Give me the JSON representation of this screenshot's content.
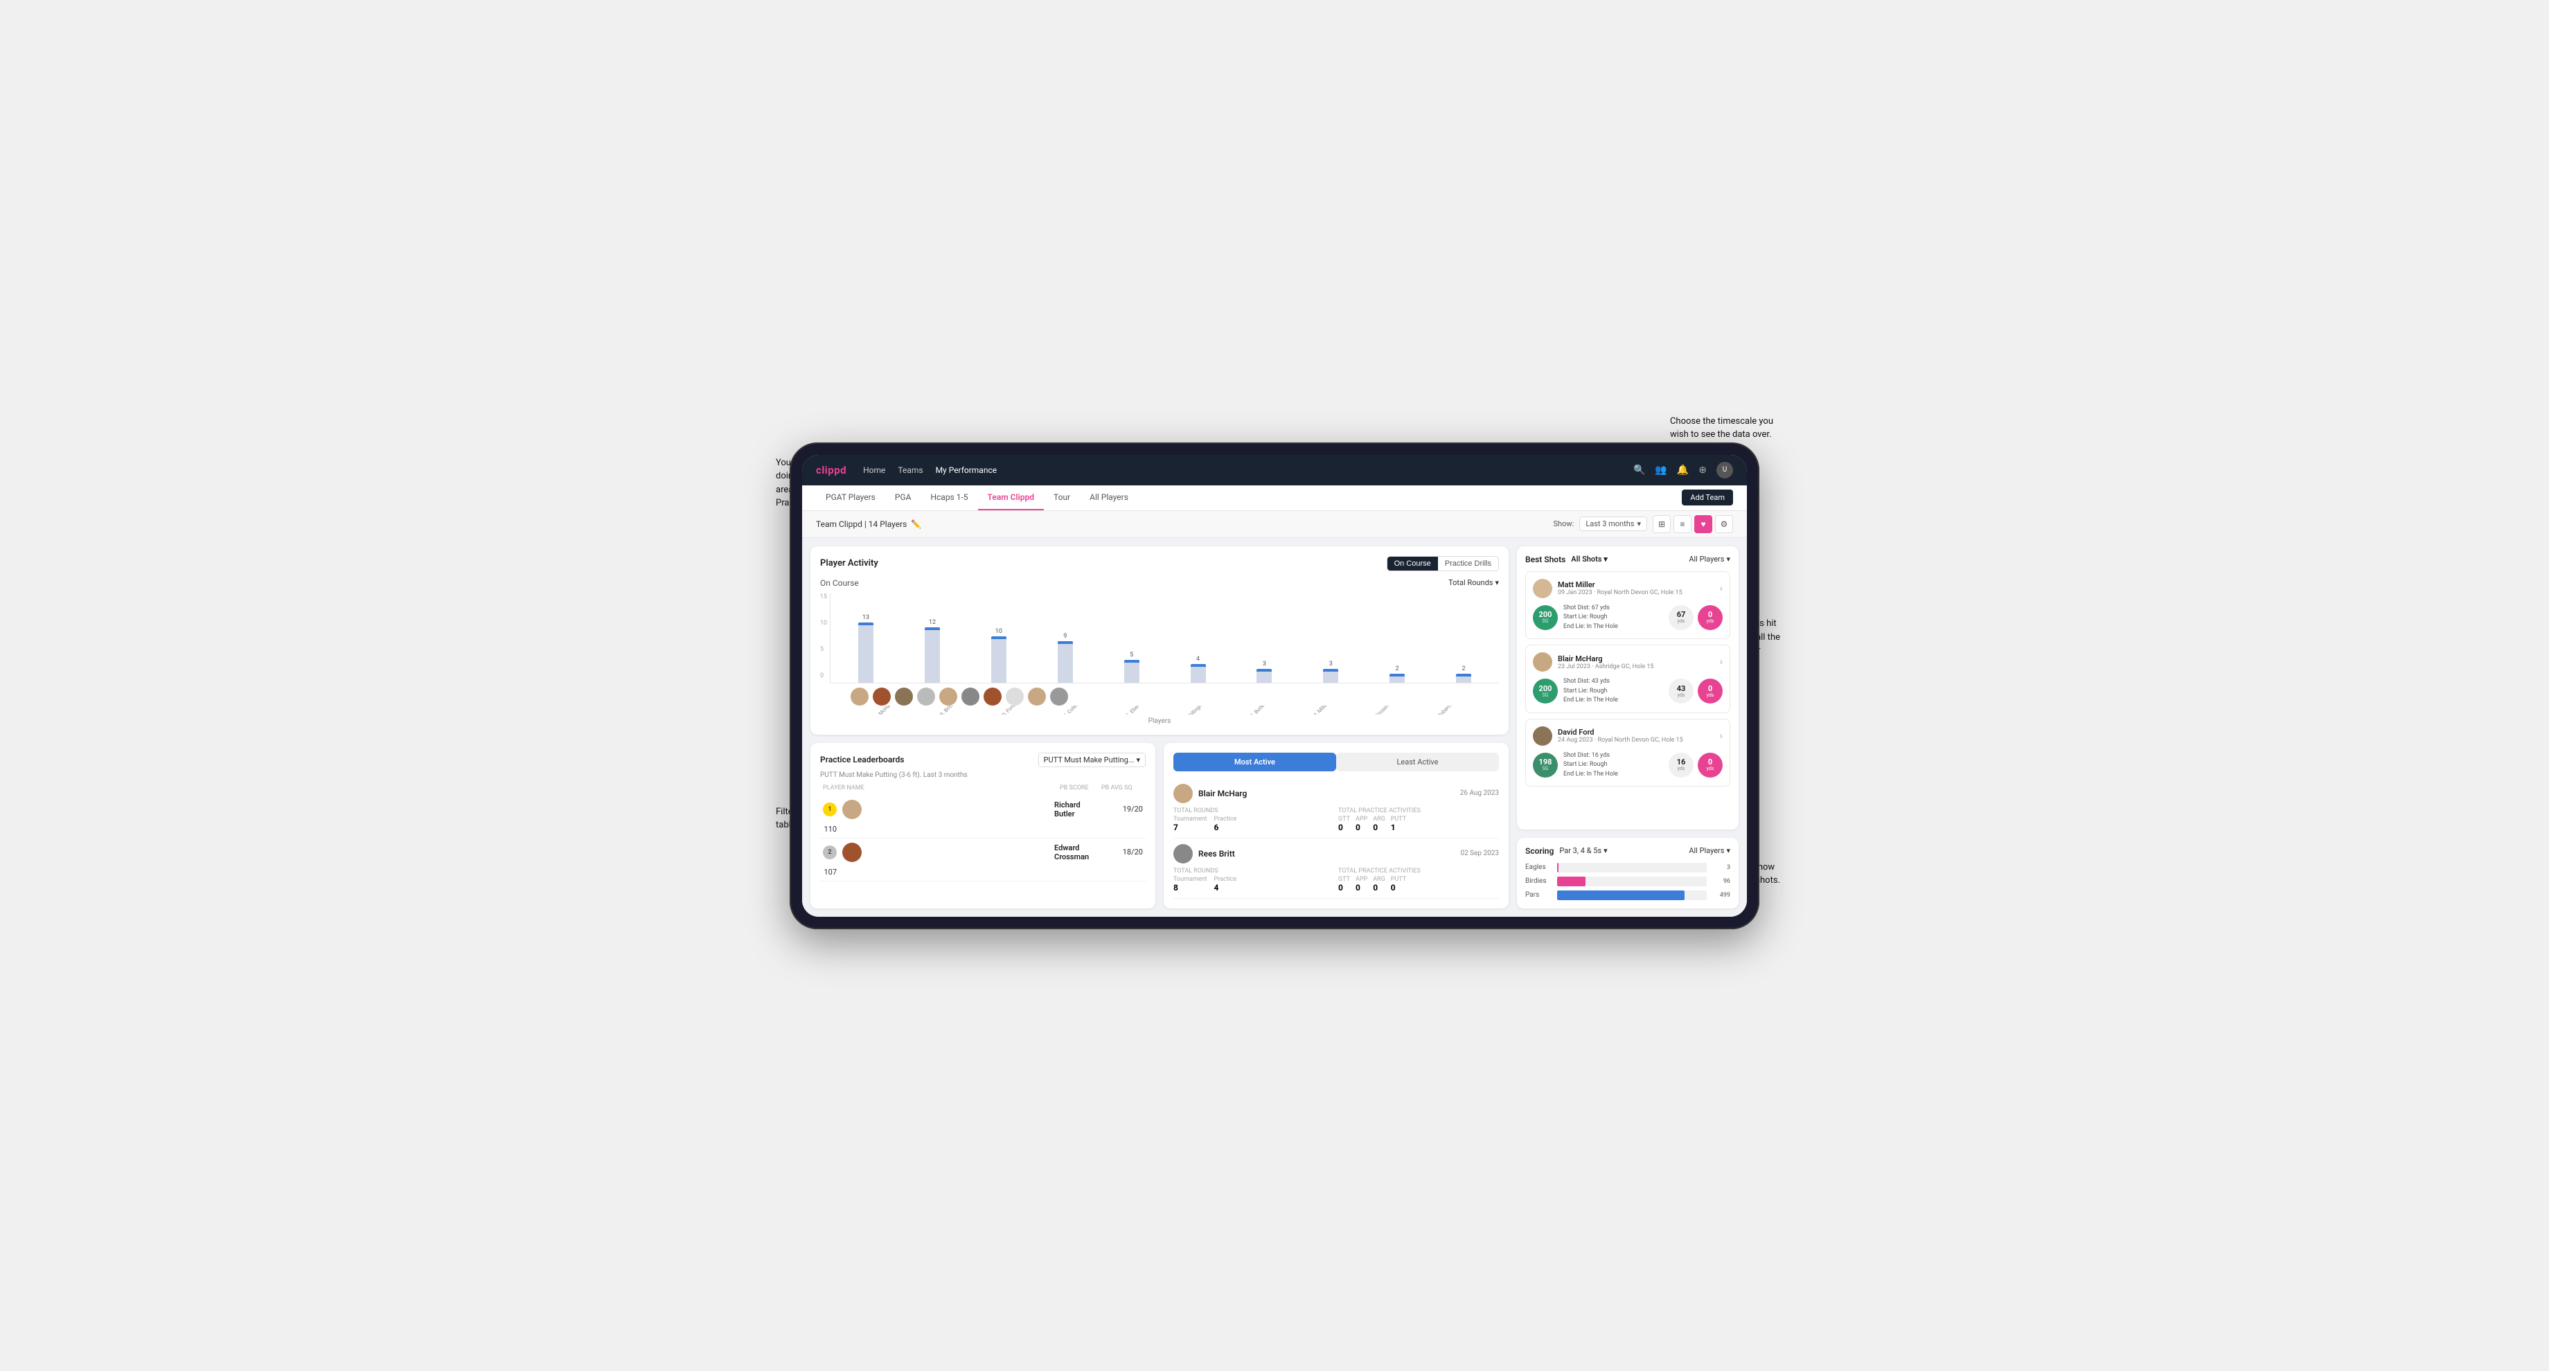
{
  "annotations": {
    "top_right": "Choose the timescale you\nwish to see the data over.",
    "top_left": "You can select which player is\ndoing the best in a range of\nareas for both On Course and\nPractice Drills.",
    "bottom_left": "Filter what data you wish the\ntable to be based on.",
    "right_mid": "Here you can see who's hit\nthe best shots out of all the\nplayers in the team for\neach department.",
    "right_bot": "You can also filter to show\njust one player's best shots."
  },
  "brand": "clippd",
  "top_nav": {
    "links": [
      "Home",
      "Teams",
      "My Performance"
    ],
    "active": "My Performance"
  },
  "sub_nav": {
    "items": [
      "PGAT Players",
      "PGA",
      "Hcaps 1-5",
      "Team Clippd",
      "Tour",
      "All Players"
    ],
    "active": "Team Clippd",
    "add_button": "Add Team"
  },
  "team_header": {
    "team_name": "Team Clippd",
    "player_count": "14 Players",
    "show_label": "Show:",
    "timescale": "Last 3 months"
  },
  "player_activity": {
    "title": "Player Activity",
    "toggle_options": [
      "On Course",
      "Practice Drills"
    ],
    "active_toggle": "On Course",
    "section_title": "On Course",
    "chart_dropdown": "Total Rounds",
    "y_label": "Total Rounds",
    "x_label": "Players",
    "y_axis_values": [
      "15",
      "10",
      "5",
      "0"
    ],
    "bars": [
      {
        "name": "B. McHarg",
        "value": 13,
        "height": 87
      },
      {
        "name": "R. Britt",
        "value": 12,
        "height": 80
      },
      {
        "name": "D. Ford",
        "value": 10,
        "height": 67
      },
      {
        "name": "J. Coles",
        "value": 9,
        "height": 60
      },
      {
        "name": "E. Ebert",
        "value": 5,
        "height": 33
      },
      {
        "name": "O. Billingham",
        "value": 4,
        "height": 27
      },
      {
        "name": "R. Butler",
        "value": 3,
        "height": 20
      },
      {
        "name": "M. Miller",
        "value": 3,
        "height": 20
      },
      {
        "name": "E. Crossman",
        "value": 2,
        "height": 13
      },
      {
        "name": "L. Robertson",
        "value": 2,
        "height": 13
      }
    ]
  },
  "practice_leaderboard": {
    "title": "Practice Leaderboards",
    "dropdown_label": "PUTT Must Make Putting...",
    "subtitle": "PUTT Must Make Putting (3-6 ft). Last 3 months",
    "columns": [
      "PLAYER NAME",
      "PB SCORE",
      "PB AVG SQ"
    ],
    "rows": [
      {
        "rank": 1,
        "rank_type": "gold",
        "name": "Richard Butler",
        "avatar_color": "#c8a882",
        "pb_score": "19/20",
        "pb_avg": "110"
      },
      {
        "rank": 2,
        "rank_type": "silver",
        "name": "Edward Crossman",
        "avatar_color": "#a0522d",
        "pb_score": "18/20",
        "pb_avg": "107"
      }
    ]
  },
  "most_active": {
    "tabs": [
      "Most Active",
      "Least Active"
    ],
    "active_tab": "Most Active",
    "players": [
      {
        "name": "Blair McHarg",
        "date": "26 Aug 2023",
        "avatar_color": "#c8a882",
        "total_rounds_label": "Total Rounds",
        "tournament_label": "Tournament",
        "practice_label": "Practice",
        "total_rounds_t": "7",
        "total_rounds_p": "6",
        "practice_activities_label": "Total Practice Activities",
        "gtt_label": "GTT",
        "app_label": "APP",
        "arg_label": "ARG",
        "putt_label": "PUTT",
        "gtt": "0",
        "app": "0",
        "arg": "0",
        "putt": "1"
      },
      {
        "name": "Rees Britt",
        "date": "02 Sep 2023",
        "avatar_color": "#888",
        "total_rounds_label": "Total Rounds",
        "tournament_label": "Tournament",
        "practice_label": "Practice",
        "total_rounds_t": "8",
        "total_rounds_p": "4",
        "practice_activities_label": "Total Practice Activities",
        "gtt_label": "GTT",
        "app_label": "APP",
        "arg_label": "ARG",
        "putt_label": "PUTT",
        "gtt": "0",
        "app": "0",
        "arg": "0",
        "putt": "0"
      }
    ]
  },
  "best_shots": {
    "title": "Best Shots",
    "filter_options": [
      "All Shots",
      "All Players"
    ],
    "all_shots_active": true,
    "players_dropdown": "All Players",
    "shots": [
      {
        "player_name": "Matt Miller",
        "course": "Royal North Devon GC",
        "hole": "Hole 15",
        "date": "09 Jan 2023",
        "badge_num": "200",
        "badge_label": "SG",
        "badge_color": "#2d9d6e",
        "shot_dist": "Shot Dist: 67 yds",
        "start_lie": "Start Lie: Rough",
        "end_lie": "End Lie: In The Hole",
        "metric1_val": "67",
        "metric1_label": "yds",
        "metric2_val": "0",
        "metric2_label": "yds"
      },
      {
        "player_name": "Blair McHarg",
        "course": "Ashridge GC",
        "hole": "Hole 15",
        "date": "23 Jul 2023",
        "badge_num": "200",
        "badge_label": "SG",
        "badge_color": "#2d9d6e",
        "shot_dist": "Shot Dist: 43 yds",
        "start_lie": "Start Lie: Rough",
        "end_lie": "End Lie: In The Hole",
        "metric1_val": "43",
        "metric1_label": "yds",
        "metric2_val": "0",
        "metric2_label": "yds"
      },
      {
        "player_name": "David Ford",
        "course": "Royal North Devon GC",
        "hole": "Hole 15",
        "date": "24 Aug 2023",
        "badge_num": "198",
        "badge_label": "SG",
        "badge_color": "#2d9d6e",
        "shot_dist": "Shot Dist: 16 yds",
        "start_lie": "Start Lie: Rough",
        "end_lie": "End Lie: In The Hole",
        "metric1_val": "16",
        "metric1_label": "yds",
        "metric2_val": "0",
        "metric2_label": "yds"
      }
    ]
  },
  "scoring": {
    "title": "Scoring",
    "filter": "Par 3, 4 & 5s",
    "players_dropdown": "All Players",
    "categories": [
      {
        "label": "Eagles",
        "value": 3,
        "max": 100,
        "color": "#e84393",
        "display": "3"
      },
      {
        "label": "Birdies",
        "value": 96,
        "max": 500,
        "color": "#e84393",
        "display": "96"
      },
      {
        "label": "Pars",
        "value": 499,
        "max": 600,
        "color": "#3b7dd8",
        "display": "499"
      }
    ]
  }
}
